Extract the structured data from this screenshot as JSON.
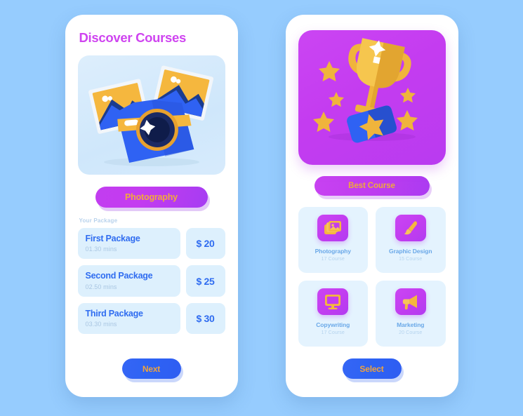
{
  "background_color": "#96ccfe",
  "left_screen": {
    "title": "Discover Courses",
    "hero_illustration": "camera-photos-illustration",
    "category_pill": "Photography",
    "section_label": "Your Package",
    "packages": [
      {
        "name": "First Package",
        "duration": "01.30 mins",
        "price": "$ 20"
      },
      {
        "name": "Second Package",
        "duration": "02.50 mins",
        "price": "$ 25"
      },
      {
        "name": "Third Package",
        "duration": "03.30 mins",
        "price": "$ 30"
      }
    ],
    "cta_label": "Next"
  },
  "right_screen": {
    "hero_illustration": "trophy-stars-illustration",
    "badge_label": "Best Course",
    "courses": [
      {
        "label": "Photography",
        "count": "17 Course",
        "icon": "photos-stack-icon"
      },
      {
        "label": "Graphic Design",
        "count": "15 Course",
        "icon": "paint-brush-icon"
      },
      {
        "label": "Copywriting",
        "count": "17 Course",
        "icon": "monitor-icon"
      },
      {
        "label": "Marketing",
        "count": "20 Course",
        "icon": "megaphone-icon"
      }
    ],
    "cta_label": "Select"
  },
  "colors": {
    "accent_purple": "#c43cf0",
    "accent_orange": "#f0a33c",
    "accent_blue": "#2f62f3",
    "text_blue": "#2f6cf0",
    "muted_blue": "#a9c6e2",
    "card_blue": "#ddf0fd"
  }
}
